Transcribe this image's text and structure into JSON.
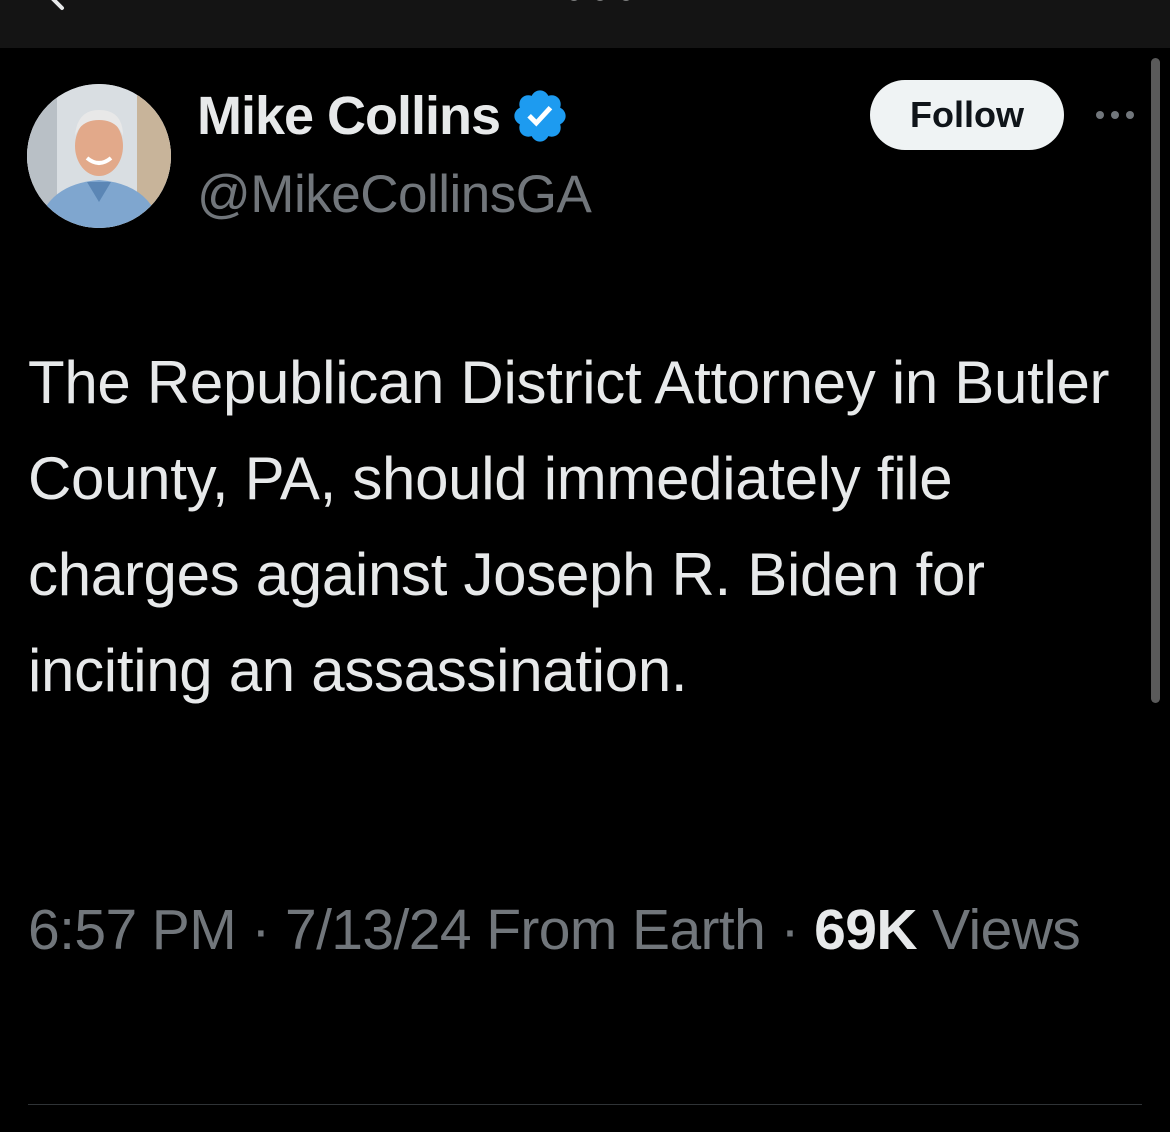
{
  "author": {
    "display_name": "Mike Collins",
    "handle": "@MikeCollinsGA",
    "verified_icon": "verified-badge-icon",
    "verified_color": "#1d9bf0"
  },
  "actions": {
    "follow_label": "Follow",
    "more_icon": "more-horizontal-icon"
  },
  "tweet": {
    "text": "The Republican District Attorney in Butler County, PA, should immediately file charges against Joseph R. Biden for inciting an assassination."
  },
  "meta": {
    "time": "6:57 PM",
    "separator": "·",
    "date": "7/13/24",
    "source": "From Earth",
    "views_count": "69K",
    "views_label": "Views"
  },
  "colors": {
    "background": "#000000",
    "primary_text": "#e7e9ea",
    "secondary_text": "#71767b",
    "follow_bg": "#eff3f4"
  }
}
